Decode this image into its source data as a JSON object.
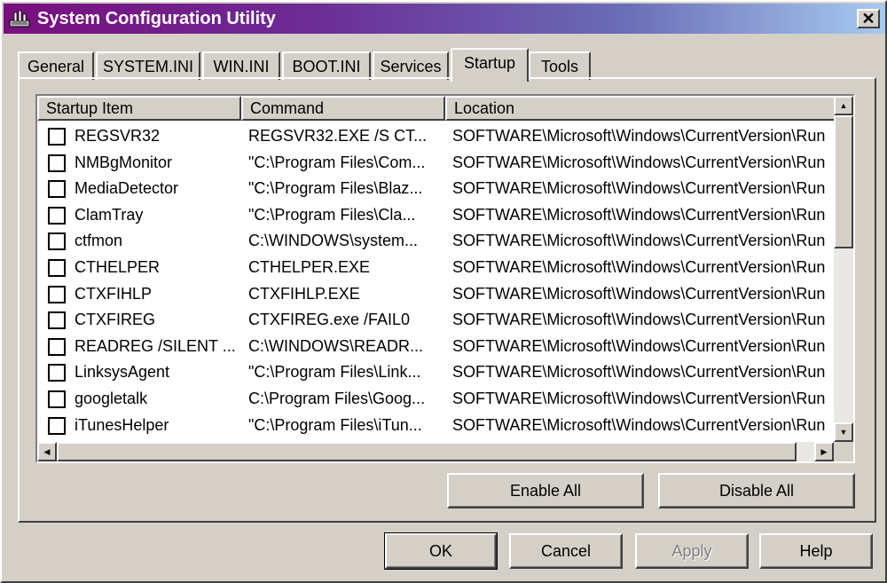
{
  "window": {
    "title": "System Configuration Utility",
    "close_glyph": "✕"
  },
  "tabs": [
    {
      "label": "General",
      "active": false
    },
    {
      "label": "SYSTEM.INI",
      "active": false
    },
    {
      "label": "WIN.INI",
      "active": false
    },
    {
      "label": "BOOT.INI",
      "active": false
    },
    {
      "label": "Services",
      "active": false
    },
    {
      "label": "Startup",
      "active": true
    },
    {
      "label": "Tools",
      "active": false
    }
  ],
  "startup": {
    "columns": [
      "Startup Item",
      "Command",
      "Location"
    ],
    "rows": [
      {
        "item": "REGSVR32",
        "command": "REGSVR32.EXE /S CT...",
        "location": "SOFTWARE\\Microsoft\\Windows\\CurrentVersion\\Run",
        "checked": false
      },
      {
        "item": "NMBgMonitor",
        "command": "\"C:\\Program Files\\Com...",
        "location": "SOFTWARE\\Microsoft\\Windows\\CurrentVersion\\Run",
        "checked": false
      },
      {
        "item": "MediaDetector",
        "command": "\"C:\\Program Files\\Blaz...",
        "location": "SOFTWARE\\Microsoft\\Windows\\CurrentVersion\\Run",
        "checked": false
      },
      {
        "item": "ClamTray",
        "command": "\"C:\\Program Files\\Cla...",
        "location": "SOFTWARE\\Microsoft\\Windows\\CurrentVersion\\Run",
        "checked": false
      },
      {
        "item": "ctfmon",
        "command": "C:\\WINDOWS\\system...",
        "location": "SOFTWARE\\Microsoft\\Windows\\CurrentVersion\\Run",
        "checked": false
      },
      {
        "item": "CTHELPER",
        "command": "CTHELPER.EXE",
        "location": "SOFTWARE\\Microsoft\\Windows\\CurrentVersion\\Run",
        "checked": false
      },
      {
        "item": "CTXFIHLP",
        "command": "CTXFIHLP.EXE",
        "location": "SOFTWARE\\Microsoft\\Windows\\CurrentVersion\\Run",
        "checked": false
      },
      {
        "item": "CTXFIREG",
        "command": "CTXFIREG.exe /FAIL0",
        "location": "SOFTWARE\\Microsoft\\Windows\\CurrentVersion\\Run",
        "checked": false
      },
      {
        "item": "READREG /SILENT ...",
        "command": "C:\\WINDOWS\\READR...",
        "location": "SOFTWARE\\Microsoft\\Windows\\CurrentVersion\\Run",
        "checked": false
      },
      {
        "item": "LinksysAgent",
        "command": "\"C:\\Program Files\\Link...",
        "location": "SOFTWARE\\Microsoft\\Windows\\CurrentVersion\\Run",
        "checked": false
      },
      {
        "item": "googletalk",
        "command": "C:\\Program Files\\Goog...",
        "location": "SOFTWARE\\Microsoft\\Windows\\CurrentVersion\\Run",
        "checked": false
      },
      {
        "item": "iTunesHelper",
        "command": "\"C:\\Program Files\\iTun...",
        "location": "SOFTWARE\\Microsoft\\Windows\\CurrentVersion\\Run",
        "checked": false
      }
    ],
    "enable_all_label": "Enable All",
    "disable_all_label": "Disable All"
  },
  "footer": {
    "ok_label": "OK",
    "cancel_label": "Cancel",
    "apply_label": "Apply",
    "apply_enabled": false,
    "help_label": "Help"
  },
  "colors": {
    "titlebar_start": "#7a0e7e",
    "titlebar_end": "#a6caf0",
    "face": "#d4d0c8"
  }
}
